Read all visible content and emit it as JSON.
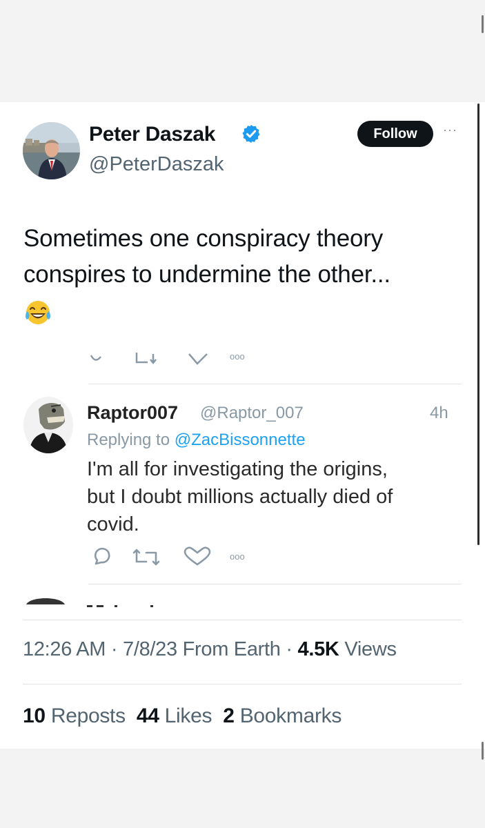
{
  "tweet": {
    "author_name": "Peter Daszak",
    "author_handle": "@PeterDaszak",
    "verified": true,
    "follow_label": "Follow",
    "more_label": "···",
    "text_line1": "Sometimes one conspiracy theory",
    "text_line2": "conspires to undermine the other...",
    "emoji": "face-with-tears-of-joy",
    "timestamp": "12:26 AM · 7/8/23",
    "source": "From Earth ·",
    "views_count": "4.5K",
    "views_label": "Views",
    "reposts_count": "10",
    "reposts_label": "Reposts",
    "likes_count": "44",
    "likes_label": "Likes",
    "bookmarks_count": "2",
    "bookmarks_label": "Bookmarks"
  },
  "quoted_reply": {
    "name": "Raptor007",
    "handle": "@Raptor_007",
    "time": "4h",
    "replying_prefix": "Replying to",
    "replying_to": "@ZacBissonnette",
    "text_line1": "I'm all for investigating the origins,",
    "text_line2": "but I doubt millions actually died of",
    "text_line3": "covid."
  },
  "colors": {
    "verified_blue": "#1d9bf0",
    "link_blue": "#1da1f2",
    "muted_gray": "#536471",
    "reply_gray": "#8899a6",
    "follow_bg": "#0f1419"
  }
}
